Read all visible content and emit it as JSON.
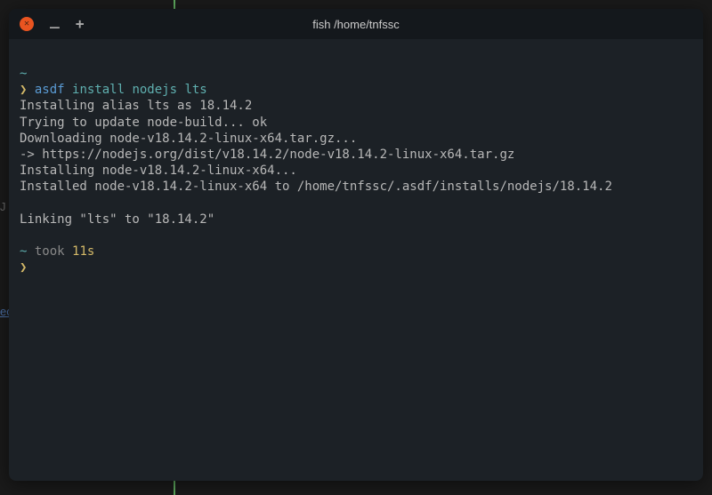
{
  "edge": {
    "gray_char": "J",
    "link_text": "ec"
  },
  "titlebar": {
    "close_glyph": "✕",
    "minimize_glyph": "_",
    "newtab_glyph": "+",
    "title": "fish /home/tnfssc"
  },
  "term": {
    "tilde1": "~",
    "prompt1": "❯",
    "cmd_asdf": "asdf",
    "cmd_args": " install nodejs lts",
    "l1": "Installing alias lts as 18.14.2",
    "l2": "Trying to update node-build... ok",
    "l3": "Downloading node-v18.14.2-linux-x64.tar.gz...",
    "l4": "-> https://nodejs.org/dist/v18.14.2/node-v18.14.2-linux-x64.tar.gz",
    "l5": "Installing node-v18.14.2-linux-x64...",
    "l6": "Installed node-v18.14.2-linux-x64 to /home/tnfssc/.asdf/installs/nodejs/18.14.2",
    "l7": "Linking \"lts\" to \"18.14.2\"",
    "tilde2": "~",
    "took": " took ",
    "duration": "11s",
    "prompt2": "❯"
  }
}
